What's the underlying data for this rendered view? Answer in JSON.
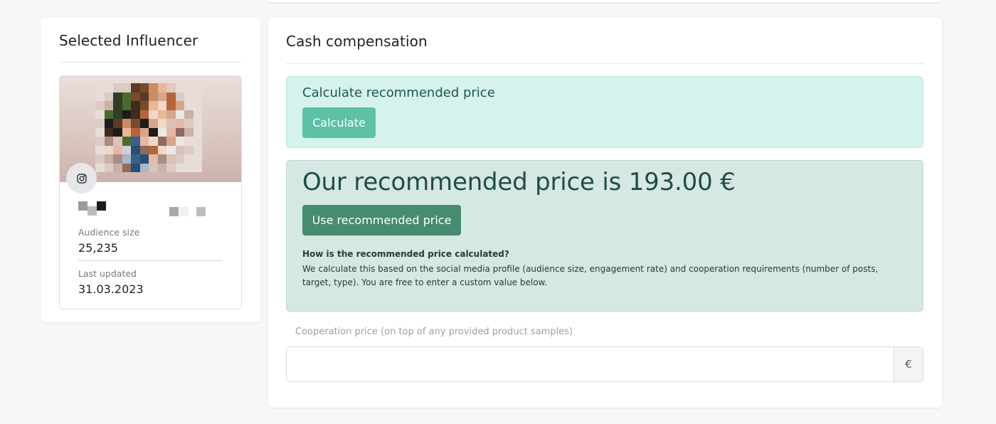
{
  "influencer_card": {
    "title": "Selected Influencer",
    "platform_icon": "instagram-icon",
    "audience_size_label": "Audience size",
    "audience_size_value": "25,235",
    "last_updated_label": "Last updated",
    "last_updated_value": "31.03.2023"
  },
  "compensation_card": {
    "title": "Cash compensation",
    "calculate_section": {
      "title": "Calculate recommended price",
      "button_label": "Calculate"
    },
    "recommendation": {
      "headline": "Our recommended price is 193.00 €",
      "button_label": "Use recommended price",
      "how_title": "How is the recommended price calculated?",
      "how_text": "We calculate this based on the social media profile (audience size, engagement rate) and cooperation requirements (number of posts, target, type). You are free to enter a custom value below."
    },
    "price_field": {
      "label": "Cooperation price (on top of any provided product samples)",
      "value": "",
      "currency_symbol": "€"
    }
  },
  "colors": {
    "calc_box_bg": "#d5f2ec",
    "calc_button": "#5ec0a6",
    "rec_box_bg": "#d6e8e4",
    "use_button": "#458c70",
    "page_bg": "#f6f7f9"
  }
}
